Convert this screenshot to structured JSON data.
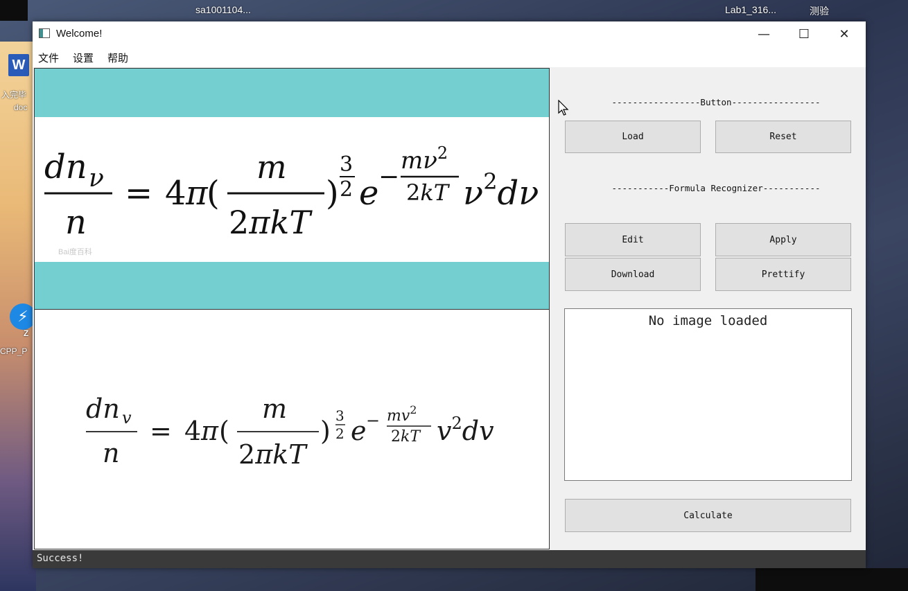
{
  "desktop": {
    "top_left_text": "sa1001104...",
    "top_right_text_1": "Lab1_316...",
    "top_right_text_2": "测验",
    "icon_word_letter": "W",
    "icon_word_label_1": "入完毕",
    "icon_word_label_2": "doc",
    "icon_app_label": "CPP_P",
    "icon_app_badge": "Z"
  },
  "window": {
    "title": "Welcome!",
    "minimize_glyph": "—",
    "maximize_glyph": "☐",
    "close_glyph": "✕"
  },
  "menu": {
    "items": [
      "文件",
      "设置",
      "帮助"
    ]
  },
  "image_pane": {
    "watermark": "Bai度百科"
  },
  "right_panel": {
    "button_header": "-----------------Button-----------------",
    "load_label": "Load",
    "reset_label": "Reset",
    "recognizer_header": "-----------Formula Recognizer-----------",
    "edit_label": "Edit",
    "apply_label": "Apply",
    "download_label": "Download",
    "prettify_label": "Prettify",
    "result_text": "No image loaded",
    "calculate_label": "Calculate"
  },
  "status": {
    "message": "Success!"
  },
  "colors": {
    "teal_band": "#73cfd0",
    "status_bar": "#3a3a3a",
    "button_face": "#e1e1e1"
  }
}
